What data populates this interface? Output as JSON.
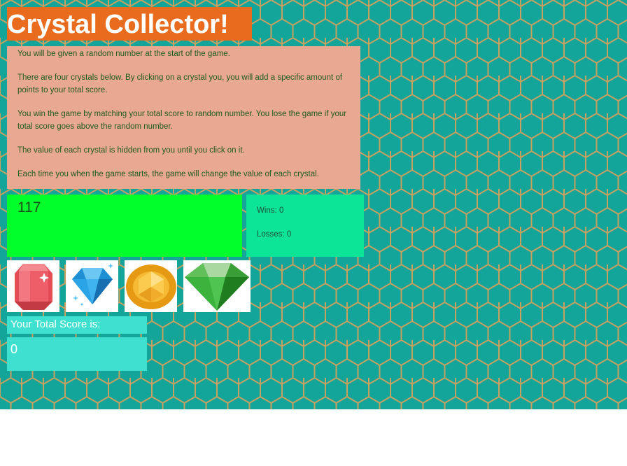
{
  "title": "Crystal Collector!",
  "instructions": [
    "You will be given a random number at the start of the game.",
    "There are four crystals below. By clicking on a crystal you, you will add a specific amount of points to your total score.",
    "You win the game by matching your total score to random number. You lose the game if your total score goes above the random number.",
    "The value of each crystal is hidden from you until you click on it.",
    "Each time you when the game starts, the game will change the value of each crystal."
  ],
  "target_number": "117",
  "stats": {
    "wins": "Wins: 0",
    "losses": "Losses: 0"
  },
  "crystals": [
    {
      "icon": "red-crystal-icon"
    },
    {
      "icon": "blue-diamond-icon"
    },
    {
      "icon": "orange-gem-icon"
    },
    {
      "icon": "green-diamond-icon"
    }
  ],
  "score": {
    "label": "Your Total Score is:",
    "value": "0"
  },
  "colors": {
    "background": "#14a59a",
    "hex_lines": "#c8a060",
    "title_bg": "#e96c1e",
    "instructions_bg": "#e9a892",
    "target_bg": "#00ff2b",
    "stats_bg": "#0ce598",
    "score_bg": "#40e0d0"
  }
}
